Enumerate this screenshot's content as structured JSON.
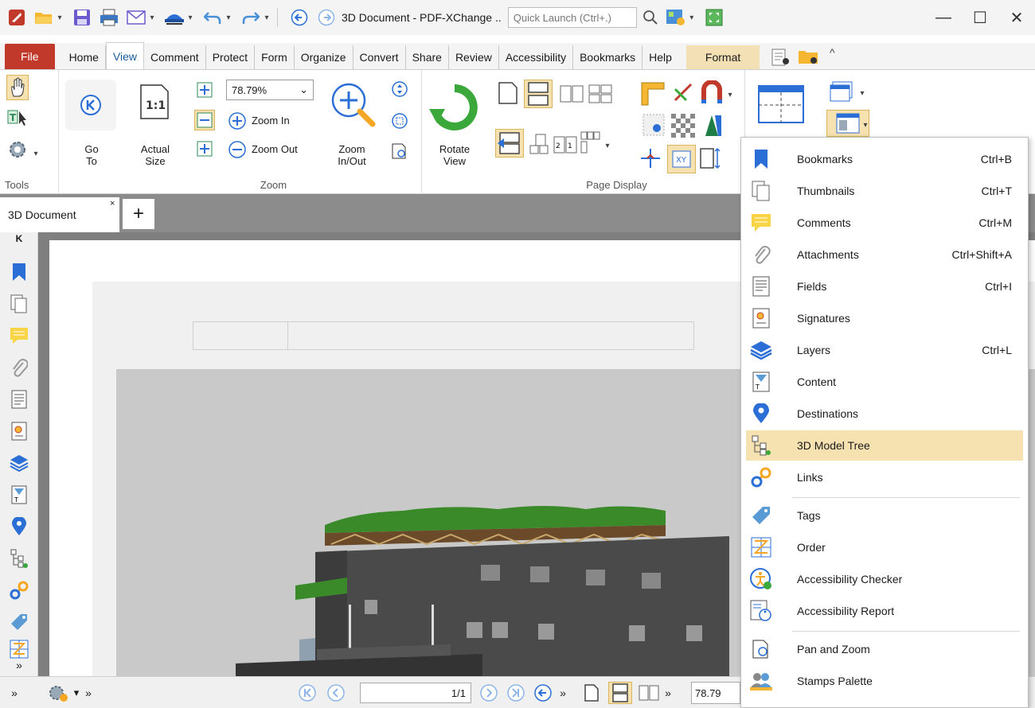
{
  "titlebar": {
    "title": "3D Document - PDF-XChange ..",
    "quick_launch_placeholder": "Quick Launch (Ctrl+.)"
  },
  "menu": {
    "file": "File",
    "tabs": [
      "Home",
      "View",
      "Comment",
      "Protect",
      "Form",
      "Organize",
      "Convert",
      "Share",
      "Review",
      "Accessibility",
      "Bookmarks",
      "Help"
    ],
    "format": "Format"
  },
  "ribbon": {
    "tools_label": "Tools",
    "go_to": "Go\nTo",
    "actual_size": "Actual\nSize",
    "zoom_value": "78.79%",
    "zoom_in": "Zoom In",
    "zoom_out": "Zoom Out",
    "zoom_inout": "Zoom\nIn/Out",
    "zoom_group": "Zoom",
    "rotate_view": "Rotate\nView",
    "page_display_group": "Page Display"
  },
  "doc_tabs": {
    "active": "3D Document",
    "close": "×",
    "new": "+"
  },
  "statusbar": {
    "page_value": "1/1",
    "zoom_value": "78.79"
  },
  "dropdown": {
    "items": [
      {
        "label": "Bookmarks",
        "shortcut": "Ctrl+B",
        "icon": "bookmark-icon"
      },
      {
        "label": "Thumbnails",
        "shortcut": "Ctrl+T",
        "icon": "thumbnails-icon"
      },
      {
        "label": "Comments",
        "shortcut": "Ctrl+M",
        "icon": "comments-icon"
      },
      {
        "label": "Attachments",
        "shortcut": "Ctrl+Shift+A",
        "icon": "attachment-icon"
      },
      {
        "label": "Fields",
        "shortcut": "Ctrl+I",
        "icon": "fields-icon"
      },
      {
        "label": "Signatures",
        "shortcut": "",
        "icon": "signatures-icon"
      },
      {
        "label": "Layers",
        "shortcut": "Ctrl+L",
        "icon": "layers-icon"
      },
      {
        "label": "Content",
        "shortcut": "",
        "icon": "content-icon"
      },
      {
        "label": "Destinations",
        "shortcut": "",
        "icon": "destinations-icon"
      },
      {
        "label": "3D Model Tree",
        "shortcut": "",
        "icon": "model-tree-icon"
      },
      {
        "label": "Links",
        "shortcut": "",
        "icon": "links-icon"
      },
      {
        "label": "Tags",
        "shortcut": "",
        "icon": "tags-icon"
      },
      {
        "label": "Order",
        "shortcut": "",
        "icon": "order-icon"
      },
      {
        "label": "Accessibility Checker",
        "shortcut": "",
        "icon": "accessibility-checker-icon"
      },
      {
        "label": "Accessibility Report",
        "shortcut": "",
        "icon": "accessibility-report-icon"
      },
      {
        "label": "Pan and Zoom",
        "shortcut": "",
        "icon": "pan-zoom-icon"
      },
      {
        "label": "Stamps Palette",
        "shortcut": "",
        "icon": "stamps-icon"
      }
    ],
    "highlighted": "3D Model Tree"
  },
  "colors": {
    "file_tab": "#c0392b",
    "format_tab": "#f3e0b5",
    "highlight": "#f6e1b0",
    "accent_blue": "#2b6fd6"
  }
}
